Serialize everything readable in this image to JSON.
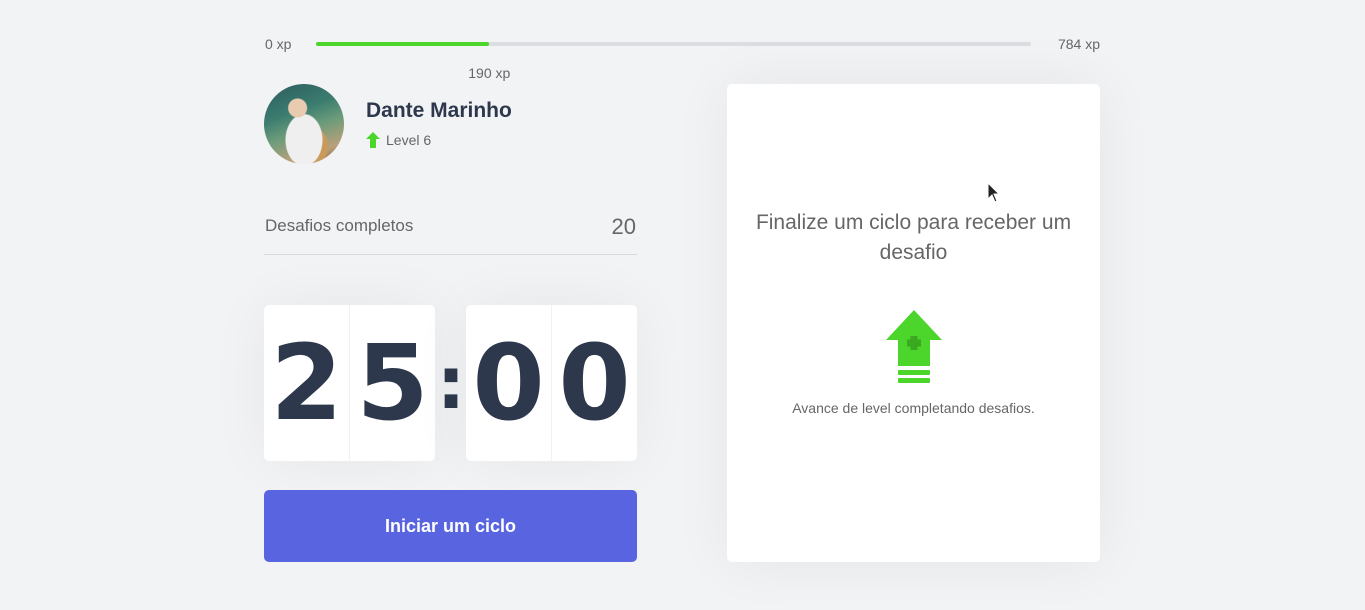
{
  "xp": {
    "min_label": "0 xp",
    "max_label": "784 xp",
    "current_label": "190 xp",
    "current": 190,
    "max": 784,
    "progress_color": "#4cd62b",
    "track_color": "#dcdde0"
  },
  "profile": {
    "name": "Dante Marinho",
    "level_label": "Level 6",
    "avatar_icon": "user-photo",
    "level_icon": "level-up-arrow-icon"
  },
  "completed": {
    "label": "Desafios completos",
    "value": "20"
  },
  "countdown": {
    "minutes": [
      "2",
      "5"
    ],
    "seconds": [
      "0",
      "0"
    ],
    "separator": ":"
  },
  "start_button": {
    "label": "Iniciar um ciclo",
    "color": "#5965e0"
  },
  "challenge": {
    "title": "Finalize um ciclo para receber um desafio",
    "hint": "Avance de level completando desafios.",
    "icon": "level-up-icon",
    "accent": "#4cd62b"
  }
}
